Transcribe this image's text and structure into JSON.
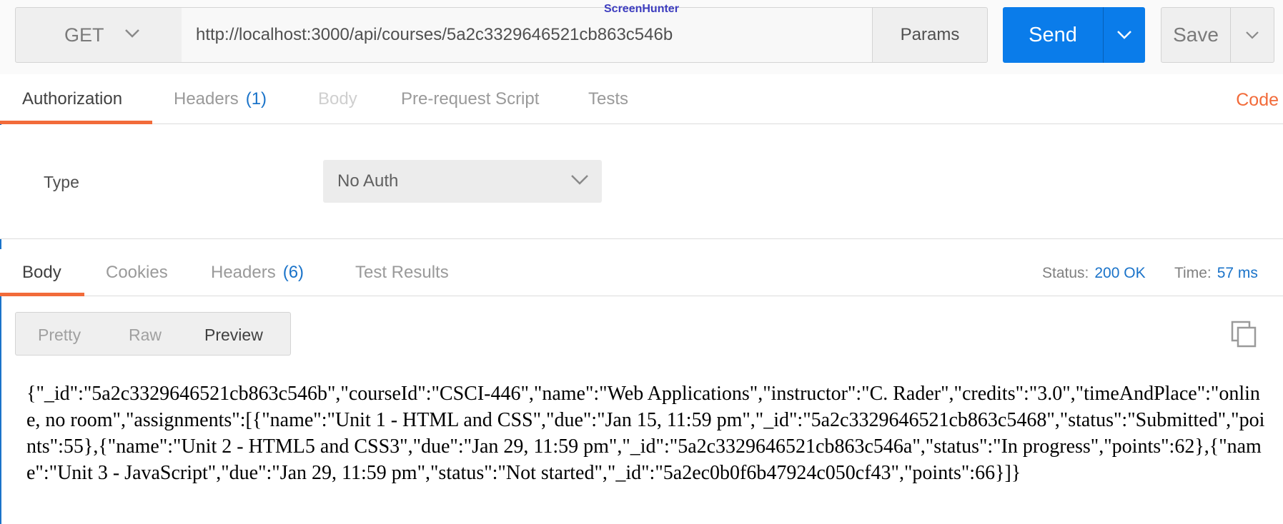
{
  "request": {
    "method": "GET",
    "url": "http://localhost:3000/api/courses/5a2c3329646521cb863c546b",
    "params_label": "Params",
    "send_label": "Send",
    "save_label": "Save",
    "watermark": "ScreenHunter"
  },
  "request_tabs": {
    "items": [
      {
        "label": "Authorization",
        "count": ""
      },
      {
        "label": "Headers",
        "count": "(1)"
      },
      {
        "label": "Body",
        "count": ""
      },
      {
        "label": "Pre-request Script",
        "count": ""
      },
      {
        "label": "Tests",
        "count": ""
      }
    ],
    "active": "Authorization",
    "code_link": "Code"
  },
  "auth": {
    "type_label": "Type",
    "type_value": "No Auth"
  },
  "response_tabs": {
    "items": [
      {
        "label": "Body",
        "count": ""
      },
      {
        "label": "Cookies",
        "count": ""
      },
      {
        "label": "Headers",
        "count": "(6)"
      },
      {
        "label": "Test Results",
        "count": ""
      }
    ],
    "active": "Body"
  },
  "response_meta": {
    "status_label": "Status:",
    "status_value": "200 OK",
    "time_label": "Time:",
    "time_value": "57 ms"
  },
  "view_modes": {
    "items": [
      "Pretty",
      "Raw",
      "Preview"
    ],
    "active": "Preview"
  },
  "response_body": "{\"_id\":\"5a2c3329646521cb863c546b\",\"courseId\":\"CSCI-446\",\"name\":\"Web Applications\",\"instructor\":\"C. Rader\",\"credits\":\"3.0\",\"timeAndPlace\":\"online, no room\",\"assignments\":[{\"name\":\"Unit 1 - HTML and CSS\",\"due\":\"Jan 15, 11:59 pm\",\"_id\":\"5a2c3329646521cb863c5468\",\"status\":\"Submitted\",\"points\":55},{\"name\":\"Unit 2 - HTML5 and CSS3\",\"due\":\"Jan 29, 11:59 pm\",\"_id\":\"5a2c3329646521cb863c546a\",\"status\":\"In progress\",\"points\":62},{\"name\":\"Unit 3 - JavaScript\",\"due\":\"Jan 29, 11:59 pm\",\"status\":\"Not started\",\"_id\":\"5a2ec0b0f6b47924c050cf43\",\"points\":66}]}",
  "colors": {
    "accent_blue": "#0a7cea",
    "tab_underline": "#f26b3a",
    "link_blue": "#1a73c9"
  }
}
